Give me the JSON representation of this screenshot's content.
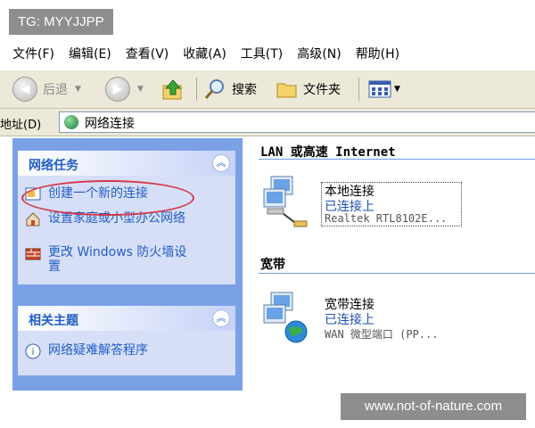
{
  "watermarks": {
    "top": "TG: MYYJJPP",
    "bottom": "www.not-of-nature.com"
  },
  "menu": [
    "文件(F)",
    "编辑(E)",
    "查看(V)",
    "收藏(A)",
    "工具(T)",
    "高级(N)",
    "帮助(H)"
  ],
  "toolbar": {
    "back": "后退",
    "search": "搜索",
    "folders": "文件夹"
  },
  "address": {
    "label": "地址(D)",
    "value": "网络连接"
  },
  "network_tasks": {
    "title": "网络任务",
    "items": [
      "创建一个新的连接",
      "设置家庭或小型办公网络",
      "更改 Windows 防火墙设置"
    ]
  },
  "related": {
    "title": "相关主题",
    "items": [
      "网络疑难解答程序"
    ]
  },
  "sections": {
    "lan": {
      "title": "LAN 或高速 Internet",
      "name": "本地连接",
      "status": "已连接上",
      "device": "Realtek RTL8102E..."
    },
    "broadband": {
      "title": "宽带",
      "name": "宽带连接",
      "status": "已连接上",
      "device": "WAN 微型端口 (PP..."
    }
  },
  "colors": {
    "task_link": "#215dc6",
    "left_pane": "#7aa1e6",
    "annotation": "#d33a4a"
  }
}
